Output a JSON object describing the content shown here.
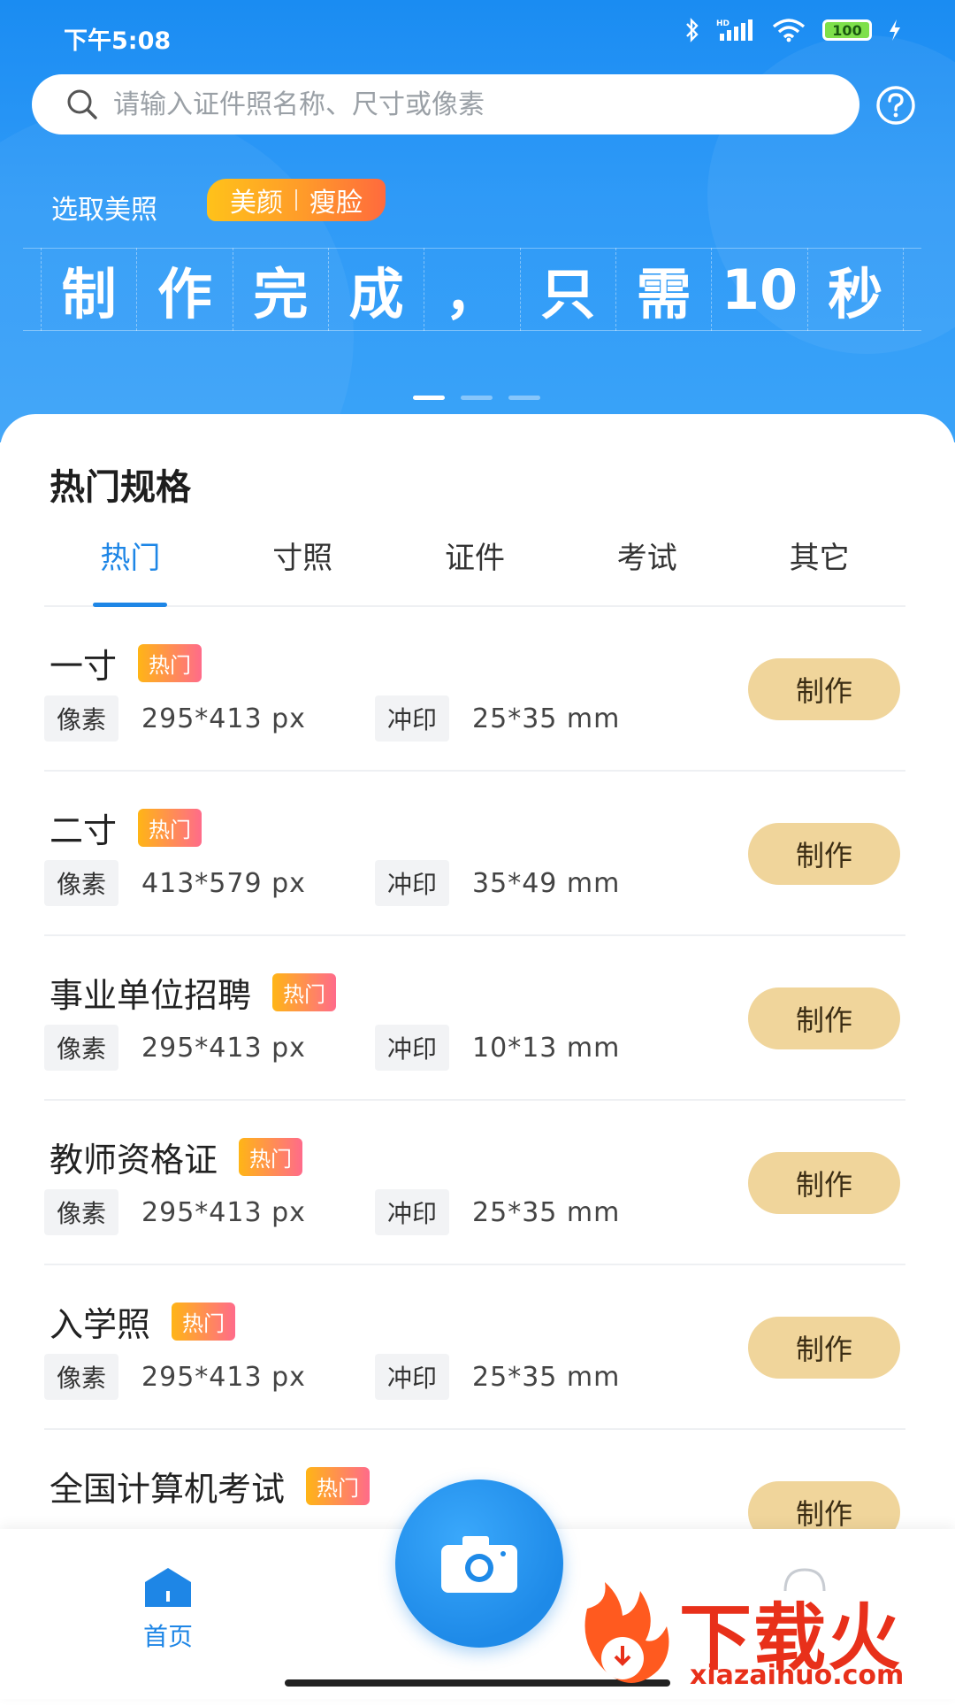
{
  "status_bar": {
    "time": "下午5:08",
    "battery": "100"
  },
  "search": {
    "placeholder": "请输入证件照名称、尺寸或像素"
  },
  "banner": {
    "label": "选取美照",
    "chip_left": "美颜",
    "chip_right": "瘦脸",
    "headline_chars": [
      "制",
      "作",
      "完",
      "成",
      "，",
      "只",
      "需",
      "10",
      "秒"
    ]
  },
  "section": {
    "title": "热门规格"
  },
  "tabs": [
    {
      "label": "热门"
    },
    {
      "label": "寸照"
    },
    {
      "label": "证件"
    },
    {
      "label": "考试"
    },
    {
      "label": "其它"
    }
  ],
  "list": {
    "pixel_label": "像素",
    "print_label": "冲印",
    "hot_label": "热门",
    "make_label": "制作",
    "items": [
      {
        "name": "一寸",
        "pixels": "295*413 px",
        "print": "25*35 mm"
      },
      {
        "name": "二寸",
        "pixels": "413*579 px",
        "print": "35*49 mm"
      },
      {
        "name": "事业单位招聘",
        "pixels": "295*413 px",
        "print": "10*13 mm"
      },
      {
        "name": "教师资格证",
        "pixels": "295*413 px",
        "print": "25*35 mm"
      },
      {
        "name": "入学照",
        "pixels": "295*413 px",
        "print": "25*35 mm"
      },
      {
        "name": "全国计算机考试",
        "pixels": "",
        "print": ""
      }
    ]
  },
  "nav": {
    "home_label": "首页"
  },
  "watermark": {
    "text": "下载火",
    "url": "xiazaihuo.com"
  },
  "colors": {
    "accent": "#1e86e6",
    "make_button": "#f0d59b",
    "banner": "#2f9af7"
  }
}
